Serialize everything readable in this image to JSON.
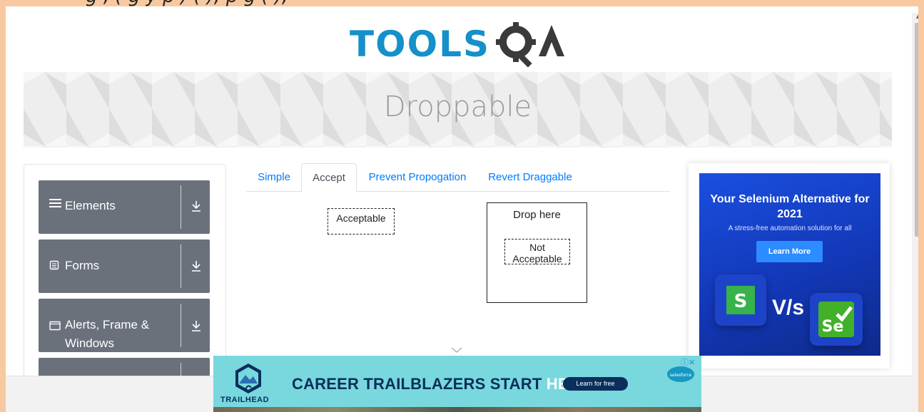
{
  "top_strip_text": "g , ( g y p ) ( ); p g ( );",
  "logo": {
    "text": "TOOLSQA"
  },
  "page_title": "Droppable",
  "sidebar": {
    "groups": [
      {
        "label": "Elements",
        "icon": "hamburger-icon"
      },
      {
        "label": "Forms",
        "icon": "form-icon"
      },
      {
        "label": "Alerts, Frame & Windows",
        "icon": "window-icon"
      },
      {
        "label": "",
        "icon": ""
      }
    ]
  },
  "tabs": [
    {
      "label": "Simple",
      "active": false
    },
    {
      "label": "Accept",
      "active": true
    },
    {
      "label": "Prevent Propogation",
      "active": false
    },
    {
      "label": "Revert Draggable",
      "active": false
    }
  ],
  "accept_tab": {
    "acceptable_label": "Acceptable",
    "not_acceptable_label": "Not Acceptable",
    "drop_label": "Drop here"
  },
  "ad_right": {
    "headline": "Your Selenium Alternative for 2021",
    "subline": "A stress-free automation solution for all",
    "cta": "Learn More",
    "vs": "V/s",
    "se_text": "Se"
  },
  "ad_bottom": {
    "headline_main": "CAREER TRAILBLAZERS START ",
    "headline_accent": "HERE.",
    "cta": "Learn for free",
    "brand": "TRAILHEAD",
    "partner": "salesforce"
  },
  "colors": {
    "accent_blue": "#007bff",
    "sidebar_group_bg": "#6b717b",
    "page_border": "#f8c9a0"
  }
}
